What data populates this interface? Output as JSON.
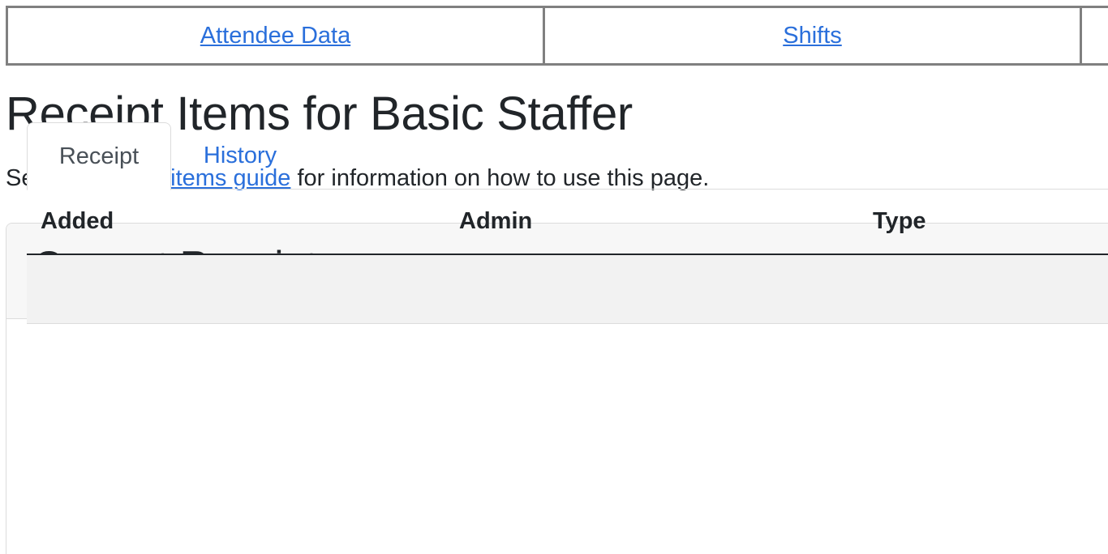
{
  "nav": {
    "links": [
      {
        "label": "Attendee Data"
      },
      {
        "label": "Shifts"
      }
    ]
  },
  "page": {
    "title": "Receipt Items for Basic Staffer",
    "intro_before": "See the ",
    "intro_link": "receipt items guide",
    "intro_after": " for information on how to use this page."
  },
  "card": {
    "title": "Current Receipt",
    "tabs": [
      {
        "label": "Receipt",
        "active": true
      },
      {
        "label": "History",
        "active": false
      }
    ],
    "table": {
      "columns": [
        "Added",
        "Admin",
        "Type"
      ]
    }
  },
  "colors": {
    "link": "#2a6fdb",
    "text": "#212529",
    "nav_border": "#808080",
    "card_header_bg": "#f7f7f7",
    "row_bg": "#f2f2f2"
  }
}
